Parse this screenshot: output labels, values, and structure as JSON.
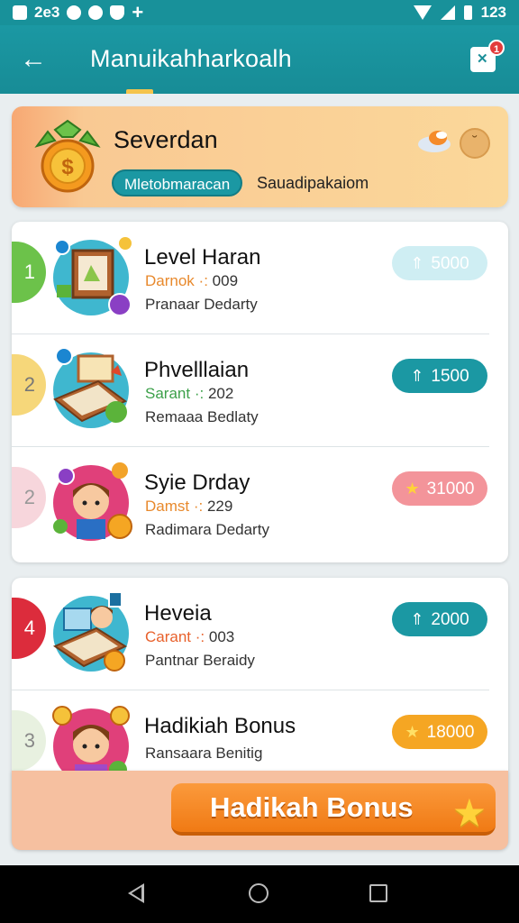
{
  "status_bar": {
    "left_text": "2e3",
    "right_text": "123"
  },
  "app_bar": {
    "title": "Manuikahharkoalh",
    "back_label": "←",
    "notification_count": "1"
  },
  "profile": {
    "name": "Severdan",
    "tag": "Mletobmaracan",
    "subtitle": "Sauadipakaiom",
    "coin_glyph": "˘"
  },
  "list": [
    {
      "rank": "1",
      "rank_color": "#6cc24a",
      "title": "Level Haran",
      "sub1_label": "Darnok",
      "sub1_value": "009",
      "sub1_color": "#e8892c",
      "sub2": "Pranaar Dedarty",
      "reward": "5000",
      "reward_icon": "arrow-up-icon",
      "reward_bg": "#cfeef3",
      "reward_fg": "#ffffff"
    },
    {
      "rank": "2",
      "rank_color": "#f6d77a",
      "title": "Phvelllaian",
      "sub1_label": "Sarant",
      "sub1_value": "202",
      "sub1_color": "#3ca04a",
      "sub2": "Remaaa Bedlaty",
      "reward": "1500",
      "reward_icon": "arrow-up-icon",
      "reward_bg": "#1b98a3",
      "reward_fg": "#ffffff"
    },
    {
      "rank": "2",
      "rank_color": "#f7d6dc",
      "title": "Syie Drday",
      "sub1_label": "Damst",
      "sub1_value": "229",
      "sub1_color": "#e8892c",
      "sub2": "Radimara Dedarty",
      "reward": "31000",
      "reward_icon": "star-icon",
      "reward_bg": "#f3949a",
      "reward_fg": "#ffffff"
    },
    {
      "rank": "4",
      "rank_color": "#dc2c3c",
      "title": "Heveia",
      "sub1_label": "Carant",
      "sub1_value": "003",
      "sub1_color": "#e8612c",
      "sub2": "Pantnar Beraidy",
      "reward": "2000",
      "reward_icon": "arrow-up-icon",
      "reward_bg": "#1b98a3",
      "reward_fg": "#ffffff"
    },
    {
      "rank": "3",
      "rank_color": "#e8f1e0",
      "title": "Hadikiah Bonus",
      "sub1_label": "",
      "sub1_value": "",
      "sub1_color": "#333333",
      "sub2": "Ransaara Benitig",
      "reward": "18000",
      "reward_icon": "star-icon",
      "reward_bg": "#f5a623",
      "reward_fg": "#ffffff"
    }
  ],
  "bonus_button": {
    "label": "Hadikah Bonus"
  }
}
